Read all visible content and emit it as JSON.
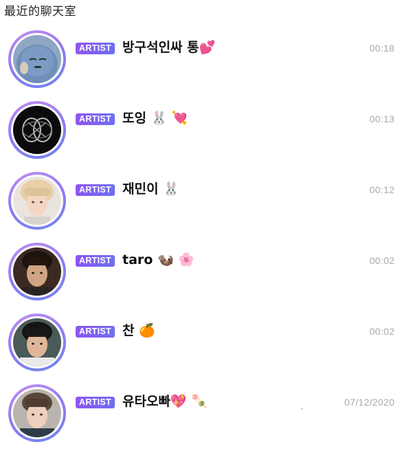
{
  "header": {
    "title": "最近的聊天室"
  },
  "chats": [
    {
      "badge": "ARTIST",
      "name": "방구석인싸 통💕",
      "time": "00:18",
      "avatar_icon": "blue-cartoon-avatar-icon"
    },
    {
      "badge": "ARTIST",
      "name": "또잉 🐰 💘",
      "time": "00:13",
      "avatar_icon": "nct-logo-avatar-icon"
    },
    {
      "badge": "ARTIST",
      "name": "재민이 🐰",
      "time": "00:12",
      "avatar_icon": "person-avatar-icon"
    },
    {
      "badge": "ARTIST",
      "name": "taro 🦦 🌸",
      "time": "00:02",
      "avatar_icon": "person-avatar-icon"
    },
    {
      "badge": "ARTIST",
      "name": "찬 🍊",
      "time": "00:02",
      "avatar_icon": "person-avatar-icon"
    },
    {
      "badge": "ARTIST",
      "name": "유타오빠💖 🍡",
      "time": "07/12/2020",
      "avatar_icon": "person-avatar-icon"
    }
  ],
  "colors": {
    "badge_gradient_start": "#8d55f2",
    "badge_gradient_end": "#6e6ff0",
    "ring_gradient_start": "#c28cf2",
    "ring_gradient_end": "#6f86ee",
    "time_text": "#a9a9a9"
  }
}
